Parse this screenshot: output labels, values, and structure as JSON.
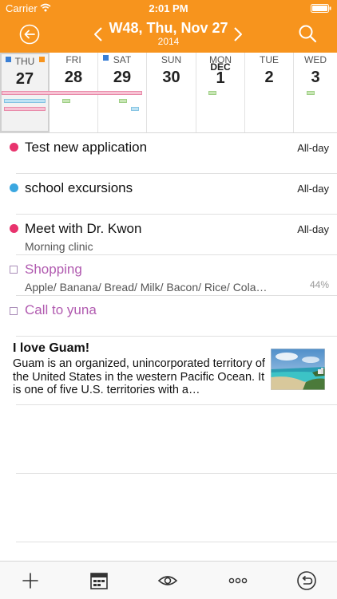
{
  "status_bar": {
    "carrier": "Carrier",
    "time": "2:01 PM"
  },
  "nav": {
    "title": "W48, Thu, Nov 27",
    "subtitle": "2014"
  },
  "week": [
    {
      "name": "THU",
      "month": "",
      "num": "27",
      "selected": true
    },
    {
      "name": "FRI",
      "month": "",
      "num": "28",
      "selected": false
    },
    {
      "name": "SAT",
      "month": "",
      "num": "29",
      "selected": false
    },
    {
      "name": "SUN",
      "month": "",
      "num": "30",
      "selected": false
    },
    {
      "name": "MON",
      "month": "DEC",
      "num": "1",
      "selected": false
    },
    {
      "name": "TUE",
      "month": "",
      "num": "2",
      "selected": false
    },
    {
      "name": "WED",
      "month": "",
      "num": "3",
      "selected": false
    }
  ],
  "events": [
    {
      "title": "Test new application",
      "allday": "All-day",
      "color": "#e8336d",
      "subtitle": ""
    },
    {
      "title": "school excursions",
      "allday": "All-day",
      "color": "#3ba7e0",
      "subtitle": ""
    },
    {
      "title": "Meet with Dr. Kwon",
      "allday": "All-day",
      "color": "#e8336d",
      "subtitle": "Morning clinic"
    }
  ],
  "todos": [
    {
      "title": "Shopping",
      "detail": "Apple/ Banana/ Bread/ Milk/ Bacon/ Rice/ Cola…",
      "progress": "44%"
    },
    {
      "title": "Call to yuna",
      "detail": "",
      "progress": ""
    }
  ],
  "note": {
    "title": "I love Guam!",
    "body": "Guam is an organized, unincorporated territory of the United States in the western Pacific Ocean. It is one of five U.S. territories with a…"
  },
  "colors": {
    "header": "#f7941d",
    "todo_text": "#b15bb0"
  },
  "tab_bar": {
    "icons": [
      "plus-icon",
      "calendar-icon",
      "eye-icon",
      "more-icon",
      "undo-icon"
    ]
  }
}
